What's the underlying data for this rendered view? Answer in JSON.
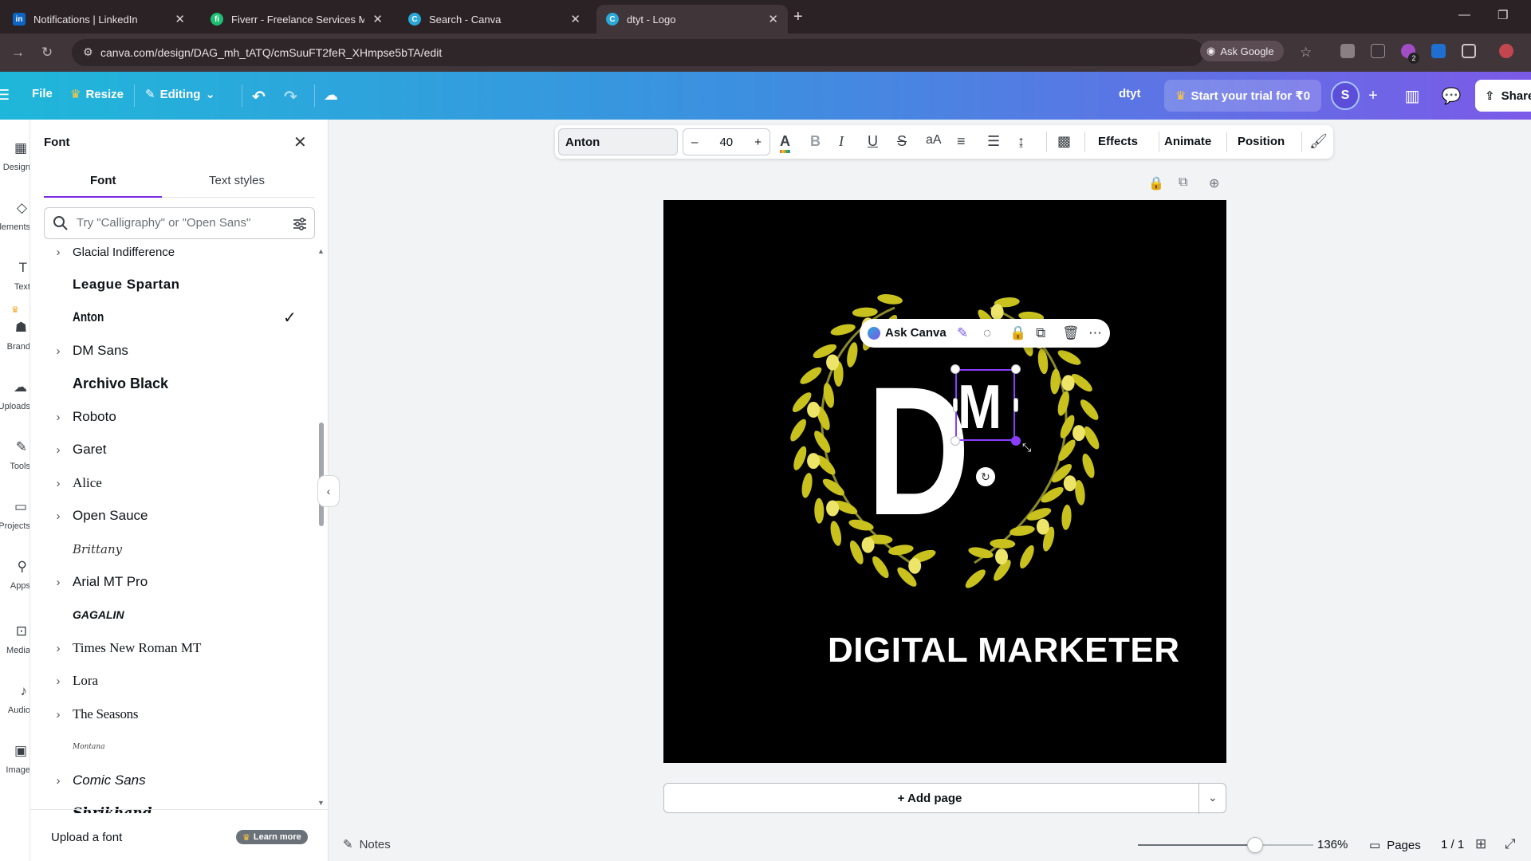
{
  "browser": {
    "tabs": [
      {
        "title": "Notifications | LinkedIn",
        "favicon": "linkedin-icon",
        "active": false
      },
      {
        "title": "Fiverr - Freelance Services Mark",
        "favicon": "fiverr-icon",
        "active": false
      },
      {
        "title": "Search - Canva",
        "favicon": "canva-icon",
        "active": false
      },
      {
        "title": "dtyt - Logo",
        "favicon": "canva-icon",
        "active": true
      }
    ],
    "url": "canva.com/design/DAG_mh_tATQ/cmSuuFT2feR_XHmpse5bTA/edit",
    "ask_google": "Ask Google",
    "extension_badge": "2"
  },
  "header": {
    "file": "File",
    "resize": "Resize",
    "editing": "Editing",
    "design_name": "dtyt",
    "trial": "Start your trial for ₹0",
    "avatar_initial": "S",
    "share": "Share",
    "gradient_start": "#1fb7d9",
    "gradient_end": "#7b5ae8"
  },
  "rail": {
    "items": [
      {
        "label": "Design",
        "icon": "design-icon"
      },
      {
        "label": "Elements",
        "icon": "elements-icon"
      },
      {
        "label": "Text",
        "icon": "text-icon"
      },
      {
        "label": "Brand",
        "icon": "brand-icon"
      },
      {
        "label": "Uploads",
        "icon": "uploads-icon"
      },
      {
        "label": "Tools",
        "icon": "tools-icon"
      },
      {
        "label": "Projects",
        "icon": "projects-icon"
      },
      {
        "label": "Apps",
        "icon": "apps-icon"
      },
      {
        "label": "Media",
        "icon": "media-icon"
      },
      {
        "label": "Audio",
        "icon": "audio-icon"
      },
      {
        "label": "Image",
        "icon": "image-icon"
      }
    ]
  },
  "font_panel": {
    "title": "Font",
    "tabs": [
      "Font",
      "Text styles"
    ],
    "search_placeholder": "Try \"Calligraphy\" or \"Open Sans\"",
    "fonts": [
      {
        "name": "Glacial Indifference",
        "has_chevron": true,
        "selected": false
      },
      {
        "name": "League Spartan",
        "has_chevron": false,
        "selected": false
      },
      {
        "name": "Anton",
        "has_chevron": false,
        "selected": true
      },
      {
        "name": "DM Sans",
        "has_chevron": true,
        "selected": false
      },
      {
        "name": "Archivo Black",
        "has_chevron": false,
        "selected": false
      },
      {
        "name": "Roboto",
        "has_chevron": true,
        "selected": false
      },
      {
        "name": "Garet",
        "has_chevron": true,
        "selected": false
      },
      {
        "name": "Alice",
        "has_chevron": true,
        "selected": false
      },
      {
        "name": "Open Sauce",
        "has_chevron": true,
        "selected": false
      },
      {
        "name": "Brittany",
        "has_chevron": false,
        "selected": false
      },
      {
        "name": "Arial MT Pro",
        "has_chevron": true,
        "selected": false
      },
      {
        "name": "GAGALIN",
        "has_chevron": false,
        "selected": false
      },
      {
        "name": "Times New Roman MT",
        "has_chevron": true,
        "selected": false
      },
      {
        "name": "Lora",
        "has_chevron": true,
        "selected": false
      },
      {
        "name": "The Seasons",
        "has_chevron": true,
        "selected": false
      },
      {
        "name": "Montana",
        "has_chevron": false,
        "selected": false
      },
      {
        "name": "Comic Sans",
        "has_chevron": true,
        "selected": false
      },
      {
        "name": "Shrikhand",
        "has_chevron": false,
        "selected": false
      }
    ],
    "upload_font": "Upload a font",
    "learn_more": "Learn more"
  },
  "toolbar": {
    "font": "Anton",
    "size_minus": "–",
    "font_size": "40",
    "size_plus": "+",
    "effects": "Effects",
    "animate": "Animate",
    "position": "Position"
  },
  "design": {
    "letter_d": "D",
    "letter_m": "M",
    "subtitle": "DIGITAL MARKETER",
    "background": "#000000",
    "wreath_color": "#c9c21e"
  },
  "context_menu": {
    "ask_canva": "Ask Canva"
  },
  "add_page": "+ Add page",
  "footer": {
    "notes": "Notes",
    "zoom": "136%",
    "pages": "Pages",
    "page_count": "1 / 1",
    "zoom_fraction": 0.67
  }
}
